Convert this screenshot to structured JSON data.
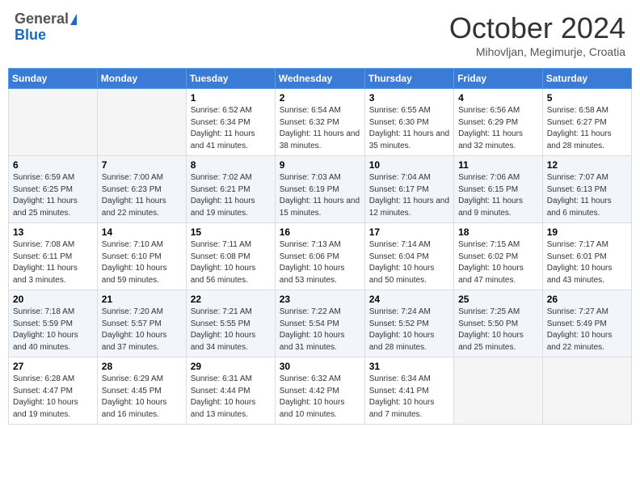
{
  "header": {
    "logo_general": "General",
    "logo_blue": "Blue",
    "month_title": "October 2024",
    "subtitle": "Mihovljan, Megimurje, Croatia"
  },
  "days_of_week": [
    "Sunday",
    "Monday",
    "Tuesday",
    "Wednesday",
    "Thursday",
    "Friday",
    "Saturday"
  ],
  "weeks": [
    [
      {
        "day": "",
        "info": ""
      },
      {
        "day": "",
        "info": ""
      },
      {
        "day": "1",
        "info": "Sunrise: 6:52 AM\nSunset: 6:34 PM\nDaylight: 11 hours and 41 minutes."
      },
      {
        "day": "2",
        "info": "Sunrise: 6:54 AM\nSunset: 6:32 PM\nDaylight: 11 hours and 38 minutes."
      },
      {
        "day": "3",
        "info": "Sunrise: 6:55 AM\nSunset: 6:30 PM\nDaylight: 11 hours and 35 minutes."
      },
      {
        "day": "4",
        "info": "Sunrise: 6:56 AM\nSunset: 6:29 PM\nDaylight: 11 hours and 32 minutes."
      },
      {
        "day": "5",
        "info": "Sunrise: 6:58 AM\nSunset: 6:27 PM\nDaylight: 11 hours and 28 minutes."
      }
    ],
    [
      {
        "day": "6",
        "info": "Sunrise: 6:59 AM\nSunset: 6:25 PM\nDaylight: 11 hours and 25 minutes."
      },
      {
        "day": "7",
        "info": "Sunrise: 7:00 AM\nSunset: 6:23 PM\nDaylight: 11 hours and 22 minutes."
      },
      {
        "day": "8",
        "info": "Sunrise: 7:02 AM\nSunset: 6:21 PM\nDaylight: 11 hours and 19 minutes."
      },
      {
        "day": "9",
        "info": "Sunrise: 7:03 AM\nSunset: 6:19 PM\nDaylight: 11 hours and 15 minutes."
      },
      {
        "day": "10",
        "info": "Sunrise: 7:04 AM\nSunset: 6:17 PM\nDaylight: 11 hours and 12 minutes."
      },
      {
        "day": "11",
        "info": "Sunrise: 7:06 AM\nSunset: 6:15 PM\nDaylight: 11 hours and 9 minutes."
      },
      {
        "day": "12",
        "info": "Sunrise: 7:07 AM\nSunset: 6:13 PM\nDaylight: 11 hours and 6 minutes."
      }
    ],
    [
      {
        "day": "13",
        "info": "Sunrise: 7:08 AM\nSunset: 6:11 PM\nDaylight: 11 hours and 3 minutes."
      },
      {
        "day": "14",
        "info": "Sunrise: 7:10 AM\nSunset: 6:10 PM\nDaylight: 10 hours and 59 minutes."
      },
      {
        "day": "15",
        "info": "Sunrise: 7:11 AM\nSunset: 6:08 PM\nDaylight: 10 hours and 56 minutes."
      },
      {
        "day": "16",
        "info": "Sunrise: 7:13 AM\nSunset: 6:06 PM\nDaylight: 10 hours and 53 minutes."
      },
      {
        "day": "17",
        "info": "Sunrise: 7:14 AM\nSunset: 6:04 PM\nDaylight: 10 hours and 50 minutes."
      },
      {
        "day": "18",
        "info": "Sunrise: 7:15 AM\nSunset: 6:02 PM\nDaylight: 10 hours and 47 minutes."
      },
      {
        "day": "19",
        "info": "Sunrise: 7:17 AM\nSunset: 6:01 PM\nDaylight: 10 hours and 43 minutes."
      }
    ],
    [
      {
        "day": "20",
        "info": "Sunrise: 7:18 AM\nSunset: 5:59 PM\nDaylight: 10 hours and 40 minutes."
      },
      {
        "day": "21",
        "info": "Sunrise: 7:20 AM\nSunset: 5:57 PM\nDaylight: 10 hours and 37 minutes."
      },
      {
        "day": "22",
        "info": "Sunrise: 7:21 AM\nSunset: 5:55 PM\nDaylight: 10 hours and 34 minutes."
      },
      {
        "day": "23",
        "info": "Sunrise: 7:22 AM\nSunset: 5:54 PM\nDaylight: 10 hours and 31 minutes."
      },
      {
        "day": "24",
        "info": "Sunrise: 7:24 AM\nSunset: 5:52 PM\nDaylight: 10 hours and 28 minutes."
      },
      {
        "day": "25",
        "info": "Sunrise: 7:25 AM\nSunset: 5:50 PM\nDaylight: 10 hours and 25 minutes."
      },
      {
        "day": "26",
        "info": "Sunrise: 7:27 AM\nSunset: 5:49 PM\nDaylight: 10 hours and 22 minutes."
      }
    ],
    [
      {
        "day": "27",
        "info": "Sunrise: 6:28 AM\nSunset: 4:47 PM\nDaylight: 10 hours and 19 minutes."
      },
      {
        "day": "28",
        "info": "Sunrise: 6:29 AM\nSunset: 4:45 PM\nDaylight: 10 hours and 16 minutes."
      },
      {
        "day": "29",
        "info": "Sunrise: 6:31 AM\nSunset: 4:44 PM\nDaylight: 10 hours and 13 minutes."
      },
      {
        "day": "30",
        "info": "Sunrise: 6:32 AM\nSunset: 4:42 PM\nDaylight: 10 hours and 10 minutes."
      },
      {
        "day": "31",
        "info": "Sunrise: 6:34 AM\nSunset: 4:41 PM\nDaylight: 10 hours and 7 minutes."
      },
      {
        "day": "",
        "info": ""
      },
      {
        "day": "",
        "info": ""
      }
    ]
  ]
}
